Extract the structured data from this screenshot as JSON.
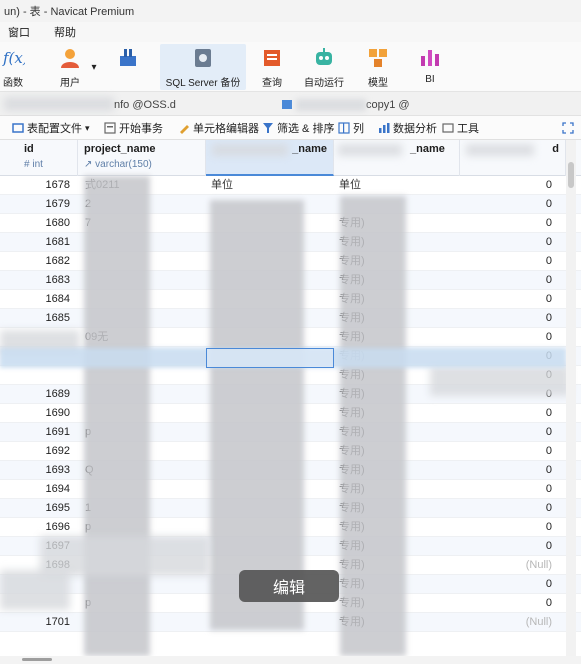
{
  "window": {
    "title": "un) - 表 - Navicat Premium"
  },
  "menu": {
    "items": [
      "窗口",
      "帮助"
    ]
  },
  "ribbon": {
    "buttons": [
      {
        "label": "函数",
        "icon": "function-icon"
      },
      {
        "label": "用户",
        "icon": "user-icon"
      },
      {
        "label": "",
        "icon": "tool-icon"
      },
      {
        "label": "SQL Server 备份",
        "icon": "backup-icon"
      },
      {
        "label": "查询",
        "icon": "query-icon"
      },
      {
        "label": "自动运行",
        "icon": "robot-icon"
      },
      {
        "label": "模型",
        "icon": "model-icon"
      },
      {
        "label": "BI",
        "icon": "bi-icon"
      }
    ]
  },
  "tabs": {
    "tab1": "nfo @OSS.d",
    "tab2": "copy1 @"
  },
  "toolbar": {
    "profile": "表配置文件",
    "transaction": "开始事务",
    "cell_editor": "单元格编辑器",
    "filter_sort": "筛选 & 排序",
    "columns": "列",
    "analysis": "数据分析",
    "tools": "工具"
  },
  "columns": [
    {
      "name": "id",
      "type": "int"
    },
    {
      "name": "project_name",
      "type": "varchar(150)"
    },
    {
      "name": "_name",
      "type": ""
    },
    {
      "name": "_name",
      "type": ""
    },
    {
      "name": "d",
      "type": ""
    }
  ],
  "rows": [
    {
      "id": "1678",
      "pn": "式0211",
      "c3": "单位",
      "c4": "单位",
      "last": "0"
    },
    {
      "id": "1679",
      "pn": "2",
      "c3": "",
      "c4": "",
      "last": "0"
    },
    {
      "id": "1680",
      "pn": "7",
      "c3": "",
      "c4": "专用)",
      "last": "0"
    },
    {
      "id": "1681",
      "pn": "",
      "c3": "",
      "c4": "专用)",
      "last": "0"
    },
    {
      "id": "1682",
      "pn": "",
      "c3": "",
      "c4": "专用)",
      "last": "0"
    },
    {
      "id": "1683",
      "pn": "",
      "c3": "",
      "c4": "专用)",
      "last": "0"
    },
    {
      "id": "1684",
      "pn": "",
      "c3": "",
      "c4": "专用)",
      "last": "0"
    },
    {
      "id": "1685",
      "pn": "",
      "c3": "",
      "c4": "专用)",
      "last": "0"
    },
    {
      "id": "",
      "pn": "09无",
      "c3": "",
      "c4": "专用)",
      "last": "0"
    },
    {
      "id": "",
      "pn": "",
      "c3": "",
      "c4": "专用)",
      "last": "0"
    },
    {
      "id": "",
      "pn": "",
      "c3": "",
      "c4": "专用)",
      "last": "0"
    },
    {
      "id": "1689",
      "pn": "",
      "c3": "",
      "c4": "专用)",
      "last": "0"
    },
    {
      "id": "1690",
      "pn": "",
      "c3": "",
      "c4": "专用)",
      "last": "0"
    },
    {
      "id": "1691",
      "pn": "p",
      "c3": "",
      "c4": "专用)",
      "last": "0"
    },
    {
      "id": "1692",
      "pn": "",
      "c3": "",
      "c4": "专用)",
      "last": "0"
    },
    {
      "id": "1693",
      "pn": "Q",
      "c3": "",
      "c4": "专用)",
      "last": "0"
    },
    {
      "id": "1694",
      "pn": "",
      "c3": "",
      "c4": "专用)",
      "last": "0"
    },
    {
      "id": "1695",
      "pn": "1",
      "c3": "",
      "c4": "专用)",
      "last": "0"
    },
    {
      "id": "1696",
      "pn": "p",
      "c3": "",
      "c4": "专用)",
      "last": "0"
    },
    {
      "id": "1697",
      "pn": "",
      "c3": "",
      "c4": "专用)",
      "last": "0"
    },
    {
      "id": "1698",
      "pn": "",
      "c3": "",
      "c4": "专用)",
      "last": "(Null)"
    },
    {
      "id": "",
      "pn": "",
      "c3": "",
      "c4": "专用)",
      "last": "0"
    },
    {
      "id": "",
      "pn": "p",
      "c3": "",
      "c4": "专用)",
      "last": "0"
    },
    {
      "id": "1701",
      "pn": "",
      "c3": "",
      "c4": "专用)",
      "last": "(Null)"
    }
  ],
  "tooltip": {
    "text": "编辑"
  }
}
